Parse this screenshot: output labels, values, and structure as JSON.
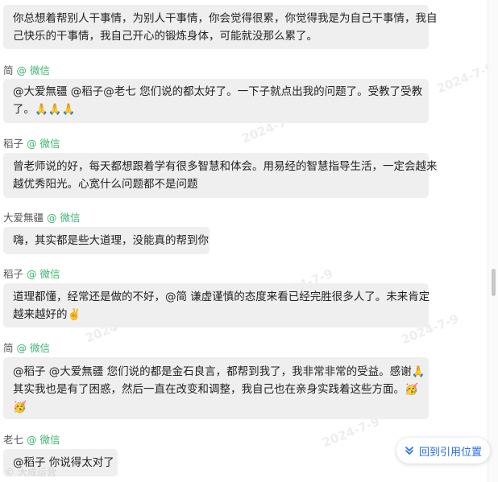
{
  "messages": [
    {
      "sender": "",
      "source": "",
      "lines": [
        "你总想着帮别人干事情，为别人干事情，你会觉得很累，你觉得我是为自己干事情，我自",
        "己快乐的干事情，我自己开心的锻炼身体，可能就没那么累了。"
      ]
    },
    {
      "sender": "简",
      "source": "@ 微信",
      "lines": [
        "@大爱無疆 @稻子@老七  您们说的都太好了。一下子就点出我的问题了。受教了受教",
        "了。🙏🙏🙏"
      ]
    },
    {
      "sender": "稻子",
      "source": "@ 微信",
      "lines": [
        "曾老师说的好，每天都想跟着学有很多智慧和体会。用易经的智慧指导生活，一定会越来",
        "越优秀阳光。心宽什么问题都不是问题"
      ]
    },
    {
      "sender": "大爱無疆",
      "source": "@ 微信",
      "lines": [
        "嗨，其实都是些大道理，没能真的帮到你"
      ]
    },
    {
      "sender": "稻子",
      "source": "@ 微信",
      "lines": [
        "道理都懂，经常还是做的不好，@简 谦虚谨慎的态度来看已经完胜很多人了。未来肯定",
        "越来越好的✌️"
      ]
    },
    {
      "sender": "简",
      "source": "@ 微信",
      "lines": [
        "@稻子 @大爱無疆 您们说的都是金石良言，都帮到我了，我非常非常的受益。感谢🙏",
        "其实我也是有了困惑，然后一直在改变和调整，我自己也在亲身实践着这些方面。🥳",
        "🥳"
      ]
    },
    {
      "sender": "老七",
      "source": "@ 微信",
      "lines": [
        "@稻子 你说得太对了"
      ]
    }
  ],
  "watermark": {
    "date": "2024-7-9",
    "footer_text": "大成运营"
  },
  "back_button": {
    "label": "回到引用位置",
    "icon": "double-chevron-down-icon"
  },
  "colors": {
    "bubble": "#efefef",
    "source_green": "#3bb46e",
    "link_blue": "#2b6de6"
  }
}
